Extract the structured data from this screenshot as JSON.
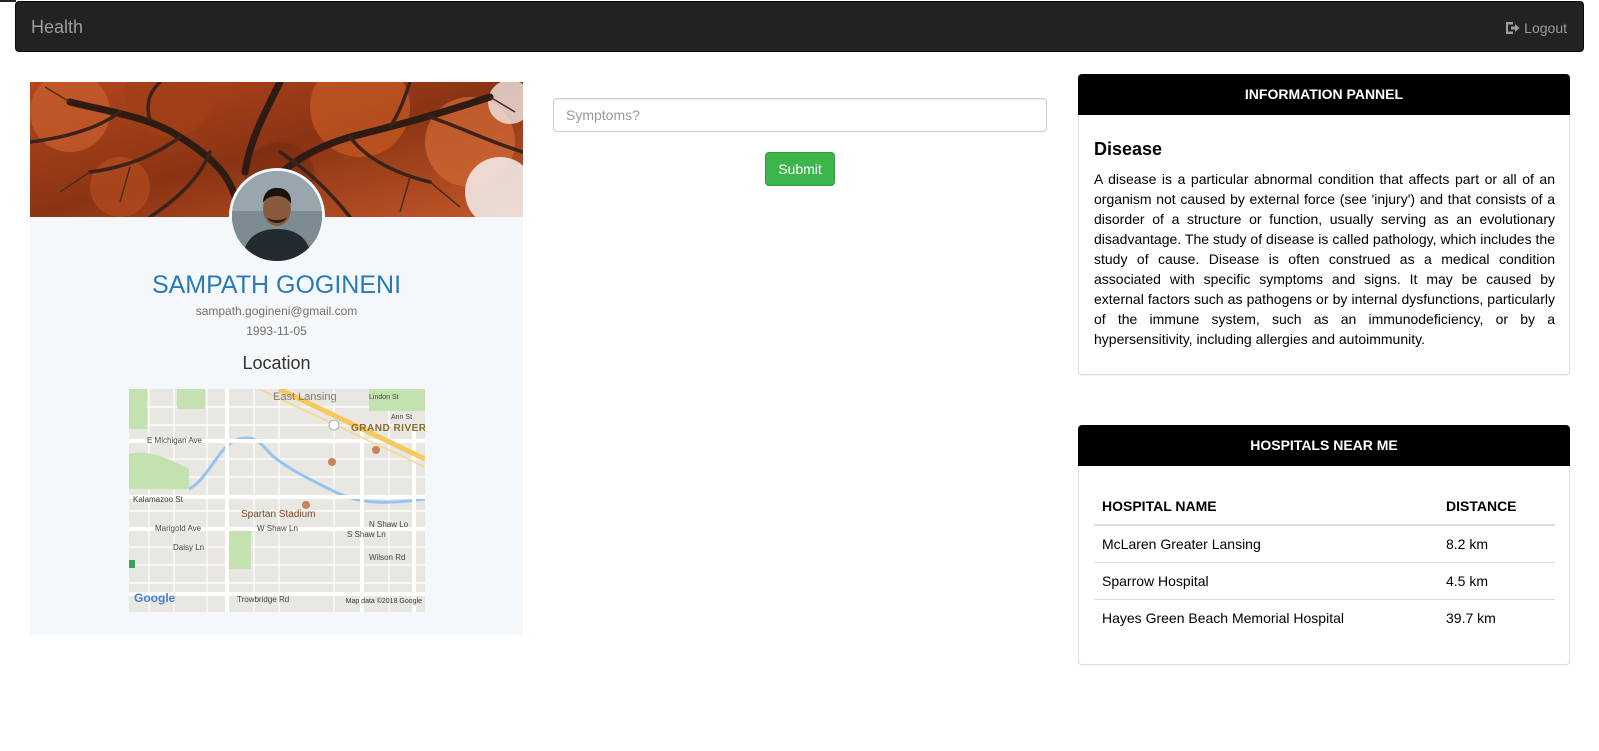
{
  "navbar": {
    "brand": "Health",
    "logout_label": "Logout",
    "logout_icon": "sign-out-icon"
  },
  "profile": {
    "name": "SAMPATH GOGINENI",
    "email": "sampath.gogineni@gmail.com",
    "dob": "1993-11-05",
    "location_heading": "Location",
    "name_color": "#2a7ab8"
  },
  "map": {
    "labels": {
      "east_lansing": "East Lansing",
      "grand_river": "GRAND RIVER",
      "e_michigan": "E Michigan Ave",
      "kalamazoo": "Kalamazoo St",
      "spartan": "Spartan Stadium",
      "w_shaw": "W Shaw Ln",
      "s_shaw": "S Shaw Ln",
      "n_shaw": "N Shaw Lo",
      "marigold": "Marigold Ave",
      "daisy": "Daisy Ln",
      "wilson": "Wilson Rd",
      "trowbridge": "Trowbridge Rd",
      "google": "Google",
      "attribution": "Map data ©2018 Google",
      "lindon": "Lindon St",
      "ann": "Ann St"
    }
  },
  "symptoms": {
    "placeholder": "Symptoms?",
    "submit_label": "Submit",
    "submit_color": "#3cb54b"
  },
  "info_panel": {
    "heading": "INFORMATION PANNEL",
    "title": "Disease",
    "body": "A disease is a particular abnormal condition that affects part or all of an organism not caused by external force (see 'injury') and that consists of a disorder of a structure or function, usually serving as an evolutionary disadvantage. The study of disease is called pathology, which includes the study of cause. Disease is often construed as a medical condition associated with specific symptoms and signs. It may be caused by external factors such as pathogens or by internal dysfunctions, particularly of the immune system, such as an immunodeficiency, or by a hypersensitivity, including allergies and autoimmunity."
  },
  "hospitals_panel": {
    "heading": "HOSPITALS NEAR ME",
    "columns": [
      "HOSPITAL NAME",
      "DISTANCE"
    ],
    "rows": [
      [
        "McLaren Greater Lansing",
        "8.2 km"
      ],
      [
        "Sparrow Hospital",
        "4.5 km"
      ],
      [
        "Hayes Green Beach Memorial Hospital",
        "39.7 km"
      ]
    ]
  }
}
